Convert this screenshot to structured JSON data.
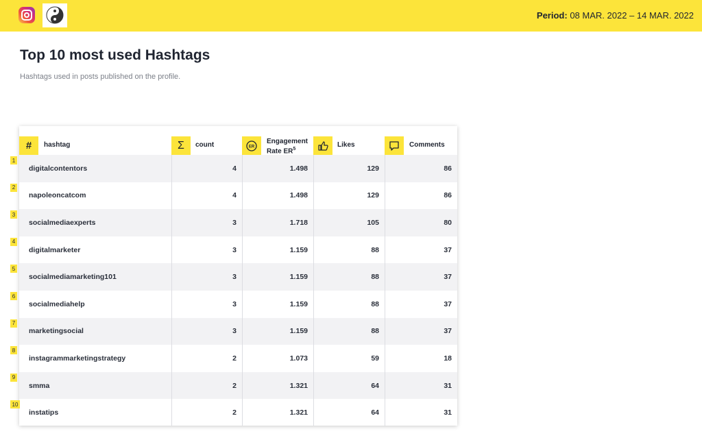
{
  "header": {
    "period_label": "Period:",
    "period_value": "08 MAR. 2022 – 14 MAR. 2022",
    "network_icon": "instagram-icon",
    "avatar_icon": "yin-yang-avatar"
  },
  "page": {
    "title": "Top 10 most used Hashtags",
    "subtitle": "Hashtags used in posts published on the profile."
  },
  "table": {
    "columns": [
      {
        "key": "hashtag",
        "label": "hashtag",
        "icon": "hash-icon"
      },
      {
        "key": "count",
        "label": "count",
        "icon": "sigma-icon"
      },
      {
        "key": "er",
        "label": "Engagement",
        "label2": "Rate ER",
        "sup": "5",
        "icon": "er-icon"
      },
      {
        "key": "likes",
        "label": "Likes",
        "icon": "thumbs-up-icon"
      },
      {
        "key": "comments",
        "label": "Comments",
        "icon": "comment-icon"
      }
    ],
    "rows": [
      {
        "rank": "1",
        "hashtag": "digitalcontentors",
        "count": "4",
        "er": "1.498",
        "likes": "129",
        "comments": "86"
      },
      {
        "rank": "2",
        "hashtag": "napoleoncatcom",
        "count": "4",
        "er": "1.498",
        "likes": "129",
        "comments": "86"
      },
      {
        "rank": "3",
        "hashtag": "socialmediaexperts",
        "count": "3",
        "er": "1.718",
        "likes": "105",
        "comments": "80"
      },
      {
        "rank": "4",
        "hashtag": "digitalmarketer",
        "count": "3",
        "er": "1.159",
        "likes": "88",
        "comments": "37"
      },
      {
        "rank": "5",
        "hashtag": "socialmediamarketing101",
        "count": "3",
        "er": "1.159",
        "likes": "88",
        "comments": "37"
      },
      {
        "rank": "6",
        "hashtag": "socialmediahelp",
        "count": "3",
        "er": "1.159",
        "likes": "88",
        "comments": "37"
      },
      {
        "rank": "7",
        "hashtag": "marketingsocial",
        "count": "3",
        "er": "1.159",
        "likes": "88",
        "comments": "37"
      },
      {
        "rank": "8",
        "hashtag": "instagrammarketingstrategy",
        "count": "2",
        "er": "1.073",
        "likes": "59",
        "comments": "18"
      },
      {
        "rank": "9",
        "hashtag": "smma",
        "count": "2",
        "er": "1.321",
        "likes": "64",
        "comments": "31"
      },
      {
        "rank": "10",
        "hashtag": "instatips",
        "count": "2",
        "er": "1.321",
        "likes": "64",
        "comments": "31"
      }
    ]
  },
  "colors": {
    "accent": "#fce43a",
    "text": "#1f2430",
    "row_alt": "#f2f2f4"
  }
}
